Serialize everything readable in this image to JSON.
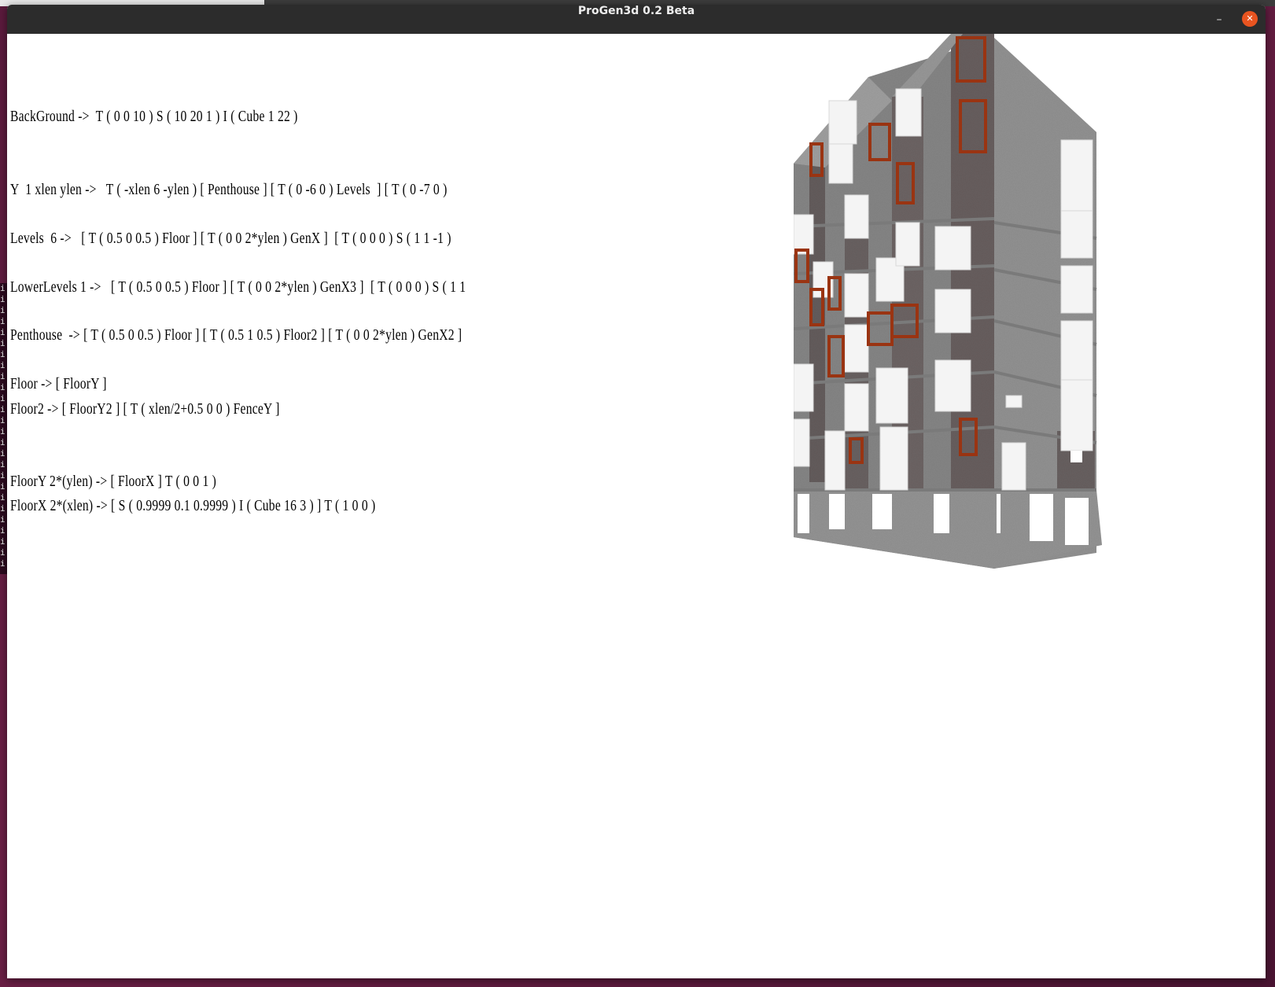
{
  "window": {
    "title": "ProGen3d 0.2 Beta",
    "minimize_glyph": "–",
    "close_glyph": "✕"
  },
  "terminal_fragment": [
    "i",
    "i",
    "i",
    "i",
    "i",
    "i",
    "i",
    "i",
    "i",
    "i",
    "i",
    "i",
    "i",
    "i",
    "i",
    "i",
    "i",
    "i",
    "i",
    "i",
    "i",
    "i",
    "i",
    "i",
    "i",
    "i"
  ],
  "rules": [
    "BackGround ->  T ( 0 0 10 ) S ( 10 20 1 ) I ( Cube 1 22 )",
    "Y  1 xlen ylen ->   T ( -xlen 6 -ylen ) [ Penthouse ] [ T ( 0 -6 0 ) Levels  ] [ T ( 0 -7 0 )",
    "Levels  6 ->   [ T ( 0.5 0 0.5 ) Floor ] [ T ( 0 0 2*ylen ) GenX ]  [ T ( 0 0 0 ) S ( 1 1 -1 )",
    "LowerLevels 1 ->   [ T ( 0.5 0 0.5 ) Floor ] [ T ( 0 0 2*ylen ) GenX3 ]  [ T ( 0 0 0 ) S ( 1 1",
    "Penthouse  -> [ T ( 0.5 0 0.5 ) Floor ] [ T ( 0.5 1 0.5 ) Floor2 ] [ T ( 0 0 2*ylen ) GenX2 ]",
    "Floor -> [ FloorY ]",
    "Floor2 -> [ FloorY2 ] [ T ( xlen/2+0.5 0 0 ) FenceY ]",
    "FloorY 2*(ylen) -> [ FloorX ] T ( 0 0 1 )",
    "FloorX 2*(xlen) -> [ S ( 0.9999 0.1 0.9999 ) I ( Cube 16 3 ) ] T ( 1 0 0 )"
  ],
  "colors": {
    "titlebar": "#2c2c2c",
    "close_button": "#e95420",
    "wall": "#8f8f8f",
    "window_frame": "#9a3412",
    "balcony": "#f2f2f2"
  }
}
